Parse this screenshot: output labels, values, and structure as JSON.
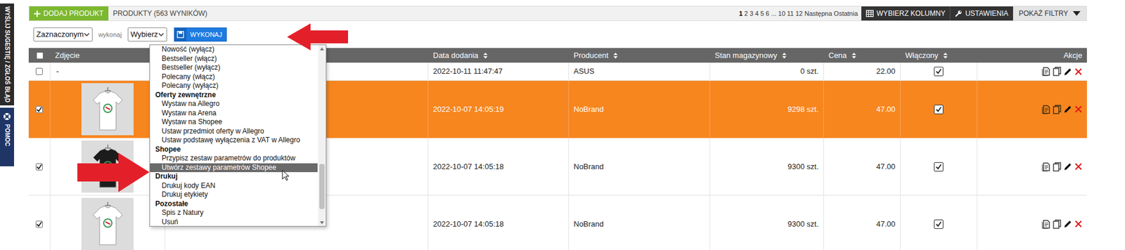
{
  "sidebar_tabs": [
    {
      "label": "WYŚLIJ SUGESTIĘ / ZGŁOŚ BŁĄD"
    },
    {
      "label": "POMOC"
    }
  ],
  "toolbar": {
    "add_button": "DODAJ PRODUKT",
    "results": "PRODUKTY (563 WYNIKÓW)",
    "pages": [
      {
        "label": "1",
        "selected": true
      },
      {
        "label": "2",
        "selected": false
      },
      {
        "label": "3",
        "selected": false
      },
      {
        "label": "4",
        "selected": false
      },
      {
        "label": "5",
        "selected": false
      },
      {
        "label": "6",
        "selected": false
      },
      {
        "label": "...",
        "selected": false
      },
      {
        "label": "10",
        "selected": false
      },
      {
        "label": "11",
        "selected": false
      },
      {
        "label": "12",
        "selected": false
      },
      {
        "label": "Następna",
        "selected": false
      },
      {
        "label": "Ostatnia",
        "selected": false
      }
    ],
    "columns_button": "WYBIERZ KOLUMNY",
    "settings_button": "USTAWIENIA",
    "filters_button": "POKAŻ FILTRY"
  },
  "bulk": {
    "scope": "Zaznaczonym",
    "label": "wykonaj",
    "action": "Wybierz",
    "submit": "WYKONAJ"
  },
  "bulk_menu": {
    "items": [
      {
        "label": "Nowość (wyłącz)",
        "kind": "option",
        "selected": false
      },
      {
        "label": "Bestseller (włącz)",
        "kind": "option",
        "selected": false
      },
      {
        "label": "Bestseller (wyłącz)",
        "kind": "option",
        "selected": false
      },
      {
        "label": "Polecany (włącz)",
        "kind": "option",
        "selected": false
      },
      {
        "label": "Polecany (wyłącz)",
        "kind": "option",
        "selected": false
      },
      {
        "label": "Oferty zewnętrzne",
        "kind": "group",
        "selected": false
      },
      {
        "label": "Wystaw na Allegro",
        "kind": "option",
        "selected": false
      },
      {
        "label": "Wystaw na Arena",
        "kind": "option",
        "selected": false
      },
      {
        "label": "Wystaw na Shopee",
        "kind": "option",
        "selected": false
      },
      {
        "label": "Ustaw przedmiot oferty w Allegro",
        "kind": "option",
        "selected": false
      },
      {
        "label": "Ustaw podstawę wyłączenia z VAT w Allegro",
        "kind": "option",
        "selected": false
      },
      {
        "label": "Shopee",
        "kind": "group",
        "selected": false
      },
      {
        "label": "Przypisz zestaw parametrów do produktów",
        "kind": "option",
        "selected": false
      },
      {
        "label": "Utwórz zestawy parametrów Shopee",
        "kind": "option",
        "selected": true
      },
      {
        "label": "Drukuj",
        "kind": "group",
        "selected": false
      },
      {
        "label": "Drukuj kody EAN",
        "kind": "option",
        "selected": false
      },
      {
        "label": "Drukuj etykiety",
        "kind": "option",
        "selected": false
      },
      {
        "label": "Pozostałe",
        "kind": "group",
        "selected": false
      },
      {
        "label": "Spis z Natury",
        "kind": "option",
        "selected": false
      },
      {
        "label": "Usuń",
        "kind": "option",
        "selected": false
      }
    ]
  },
  "table": {
    "select_all_checked": false,
    "columns": [
      {
        "label": "Zdjęcie",
        "sortable": false
      },
      {
        "label": "Data dodania",
        "sortable": true
      },
      {
        "label": "Producent",
        "sortable": true
      },
      {
        "label": "Stan magazynowy",
        "sortable": true
      },
      {
        "label": "Cena",
        "sortable": true
      },
      {
        "label": "Włączony",
        "sortable": true
      },
      {
        "label": "Akcje",
        "sortable": false
      }
    ],
    "rows": [
      {
        "checked": false,
        "selected": false,
        "photo": "-",
        "photo_color": "",
        "date": "2022-10-11 11:47:47",
        "producer": "ASUS",
        "stock": "0 szt.",
        "price": "22.00",
        "enabled": true
      },
      {
        "checked": true,
        "selected": true,
        "photo": "",
        "photo_color": "#ffffff",
        "date": "2022-10-07 14:05:19",
        "producer": "NoBrand",
        "stock": "9298 szt.",
        "price": "47.00",
        "enabled": true
      },
      {
        "checked": true,
        "selected": false,
        "photo": "",
        "photo_color": "#1c1c1c",
        "date": "2022-10-07 14:05:18",
        "producer": "NoBrand",
        "stock": "9300 szt.",
        "price": "47.00",
        "enabled": true
      },
      {
        "checked": true,
        "selected": false,
        "photo": "",
        "photo_color": "#ffffff",
        "date": "2022-10-07 14:05:18",
        "producer": "NoBrand",
        "stock": "9300 szt.",
        "price": "47.00",
        "enabled": true
      }
    ]
  }
}
